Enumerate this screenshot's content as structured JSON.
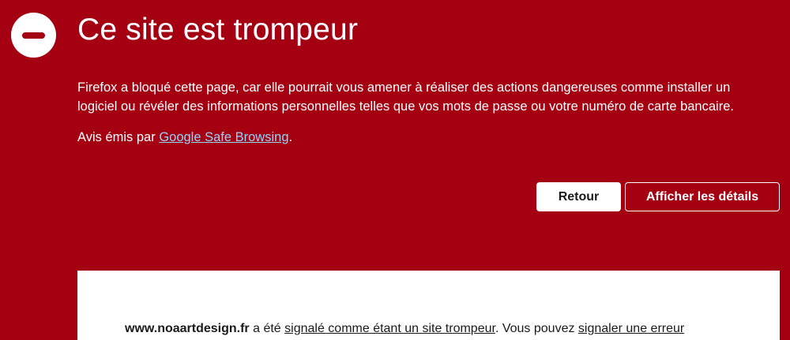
{
  "colors": {
    "background": "#a50012",
    "text": "#ffffff",
    "link": "#8fd8ff",
    "panel": "#ffffff"
  },
  "header": {
    "icon": "blocked-icon",
    "title": "Ce site est trompeur"
  },
  "description": "Firefox a bloqué cette page, car elle pourrait vous amener à réaliser des actions dangereuses comme installer un logiciel ou révéler des informations personnelles telles que vos mots de passe ou votre numéro de carte bancaire.",
  "advisory": {
    "prefix": "Avis émis par ",
    "link_label": "Google Safe Browsing",
    "suffix": "."
  },
  "buttons": {
    "back": "Retour",
    "details": "Afficher les détails"
  },
  "details": {
    "site": "www.noaartdesign.fr",
    "text_1": " a été ",
    "reported_link": "signalé comme étant un site trompeur",
    "text_2": ". Vous pouvez ",
    "report_error_link": "signaler une erreur"
  }
}
